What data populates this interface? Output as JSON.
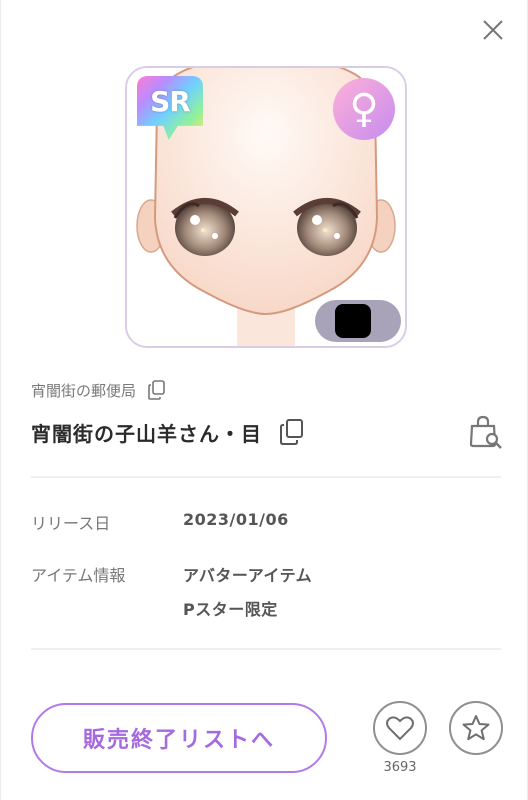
{
  "item": {
    "rarity": "SR",
    "gender_symbol": "♀",
    "brand": "宵闇街の郵便局",
    "title": "宵闇街の子山羊さん・目"
  },
  "info": {
    "release_label": "リリース日",
    "release_date": "2023/01/06",
    "item_info_label": "アイテム情報",
    "item_info_value_1": "アバターアイテム",
    "item_info_value_2": "Pスター限定"
  },
  "actions": {
    "soldout_label": "販売終了リストへ",
    "like_count": "3693"
  },
  "icons": {
    "close": "close-icon",
    "copy": "copy-icon",
    "shop": "shopping-bag-search-icon",
    "like": "heart-icon",
    "favorite": "star-icon"
  },
  "colors": {
    "accent": "#a56ae0",
    "card_border": "#d9cde6"
  }
}
